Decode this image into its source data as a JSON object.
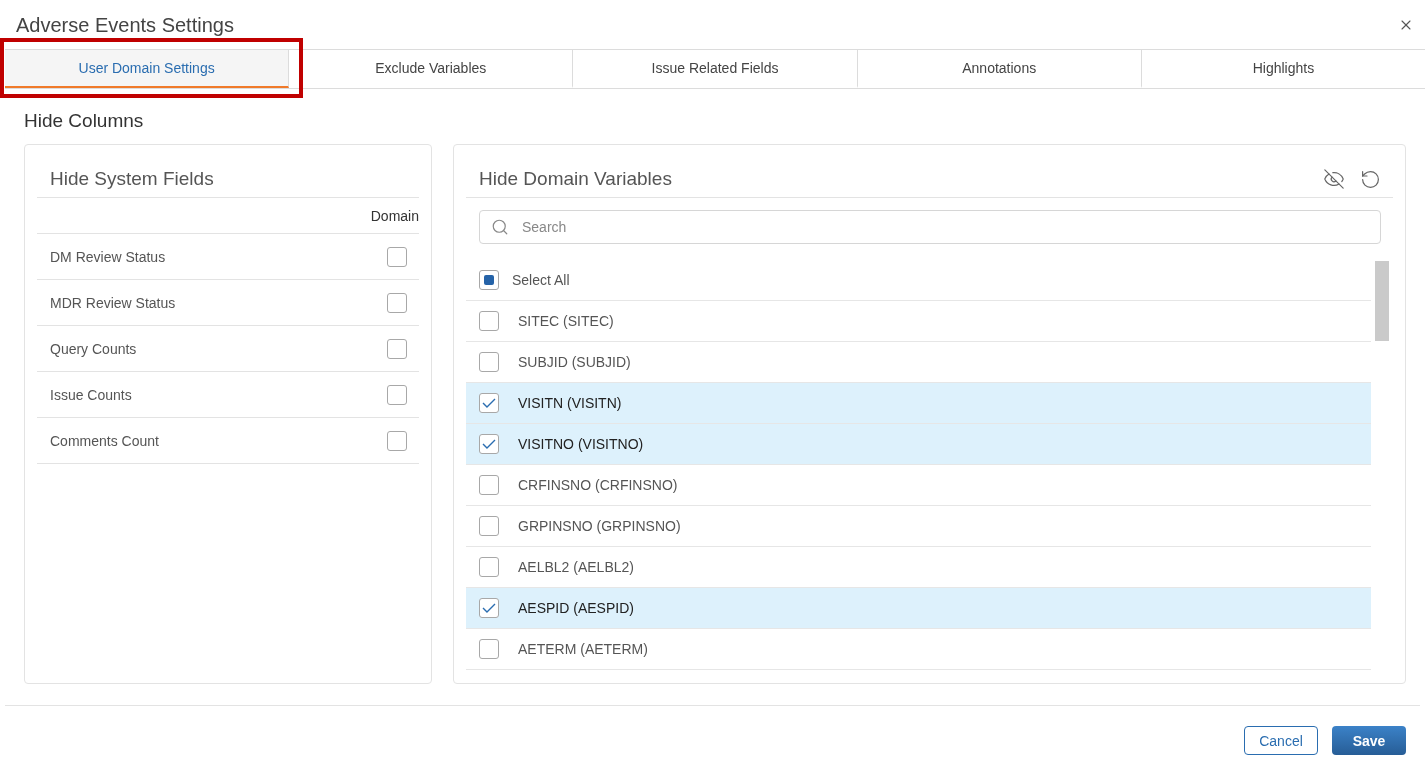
{
  "dialog": {
    "title": "Adverse Events Settings"
  },
  "tabs": [
    {
      "label": "User Domain Settings",
      "selected": true,
      "outlined": true
    },
    {
      "label": "Exclude Variables",
      "selected": false,
      "outlined": false
    },
    {
      "label": "Issue Related Fields",
      "selected": false,
      "outlined": false
    },
    {
      "label": "Annotations",
      "selected": false,
      "outlined": false
    },
    {
      "label": "Highlights",
      "selected": false,
      "outlined": false
    }
  ],
  "section_title": "Hide Columns",
  "system_fields": {
    "title": "Hide System Fields",
    "column_header": "Domain",
    "rows": [
      {
        "label": "DM Review Status",
        "checked": false
      },
      {
        "label": "MDR Review Status",
        "checked": false
      },
      {
        "label": "Query Counts",
        "checked": false
      },
      {
        "label": "Issue Counts",
        "checked": false
      },
      {
        "label": "Comments Count",
        "checked": false
      }
    ]
  },
  "domain_variables": {
    "title": "Hide Domain Variables",
    "search": {
      "placeholder": "Search"
    },
    "select_all": {
      "label": "Select All",
      "checked": false,
      "indeterminate": true
    },
    "rows": [
      {
        "label": "SITEC (SITEC)",
        "checked": false
      },
      {
        "label": "SUBJID (SUBJID)",
        "checked": false
      },
      {
        "label": "VISITN (VISITN)",
        "checked": true
      },
      {
        "label": "VISITNO (VISITNO)",
        "checked": true
      },
      {
        "label": "CRFINSNO (CRFINSNO)",
        "checked": false
      },
      {
        "label": "GRPINSNO (GRPINSNO)",
        "checked": false
      },
      {
        "label": "AELBL2 (AELBL2)",
        "checked": false
      },
      {
        "label": "AESPID (AESPID)",
        "checked": true
      },
      {
        "label": "AETERM (AETERM)",
        "checked": false
      }
    ]
  },
  "buttons": [
    {
      "label": "Cancel",
      "kind": "secondary"
    },
    {
      "label": "Save",
      "kind": "primary"
    }
  ]
}
